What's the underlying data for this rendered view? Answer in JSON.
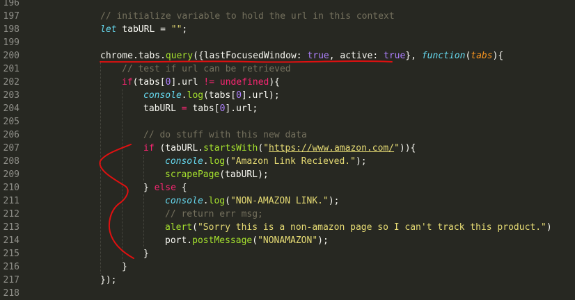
{
  "gutter": {
    "line_numbers": [
      "196",
      "197",
      "198",
      "199",
      "200",
      "201",
      "202",
      "203",
      "204",
      "205",
      "206",
      "207",
      "208",
      "209",
      "210",
      "211",
      "212",
      "213",
      "214",
      "215",
      "216",
      "217",
      "218"
    ]
  },
  "code": {
    "l197": {
      "comment": "// initialize variable to hold the url in this context"
    },
    "l198": {
      "kw": "let",
      "rest": " tabURL = ",
      "str": "\"\"",
      "end": ";"
    },
    "l200": {
      "obj": "chrome.tabs.",
      "method": "query",
      "open": "({lastFocusedWindow: ",
      "true1": "true",
      "mid": ", active: ",
      "true2": "true",
      "close": "}, ",
      "func": "function",
      "paren1": "(",
      "param": "tabs",
      "paren2": "){"
    },
    "l201": {
      "comment": "// test if url can be retrieved"
    },
    "l202": {
      "kw": "if",
      "a": "(tabs[",
      "zero": "0",
      "b": "].url ",
      "op": "!=",
      "sp": " ",
      "undef": "undefined",
      "c": "){"
    },
    "l203": {
      "console": "console",
      "dot": ".",
      "log": "log",
      "a": "(tabs[",
      "zero": "0",
      "b": "].url);"
    },
    "l204": {
      "a": "tabURL ",
      "op": "=",
      "b": " tabs[",
      "zero": "0",
      "c": "].url;"
    },
    "l206": {
      "comment": "// do stuff with this new data"
    },
    "l207": {
      "kw": "if",
      "a": " (tabURL.",
      "method": "startsWith",
      "b": "(",
      "str_open": "\"",
      "str_url": "https://www.amazon.com/",
      "str_close": "\"",
      "c": ")){"
    },
    "l208": {
      "console": "console",
      "dot": ".",
      "log": "log",
      "a": "(",
      "str": "\"Amazon Link Recieved.\"",
      "b": ");"
    },
    "l209": {
      "fn": "scrapePage",
      "a": "(tabURL);"
    },
    "l210": {
      "a": "} ",
      "kw": "else",
      "b": " {"
    },
    "l211": {
      "console": "console",
      "dot": ".",
      "log": "log",
      "a": "(",
      "str": "\"NON-AMAZON LINK.\"",
      "b": ");"
    },
    "l212": {
      "comment": "// return err msg;"
    },
    "l213": {
      "fn": "alert",
      "a": "(",
      "str": "\"Sorry this is a non-amazon page so I can't track this product.\"",
      "b": ")"
    },
    "l214": {
      "a": "port.",
      "method": "postMessage",
      "b": "(",
      "str": "\"NONAMAZON\"",
      "c": ");"
    },
    "l215": {
      "a": "}"
    },
    "l216": {
      "a": "}"
    },
    "l217": {
      "a": "});"
    }
  },
  "colors": {
    "background": "#272822",
    "comment": "#75715e",
    "keyword": "#f92672",
    "storage": "#66d9ef",
    "string": "#e6db74",
    "function": "#a6e22e",
    "constant": "#ae81ff",
    "parameter": "#fd971f",
    "annotation_red": "#e01010"
  }
}
